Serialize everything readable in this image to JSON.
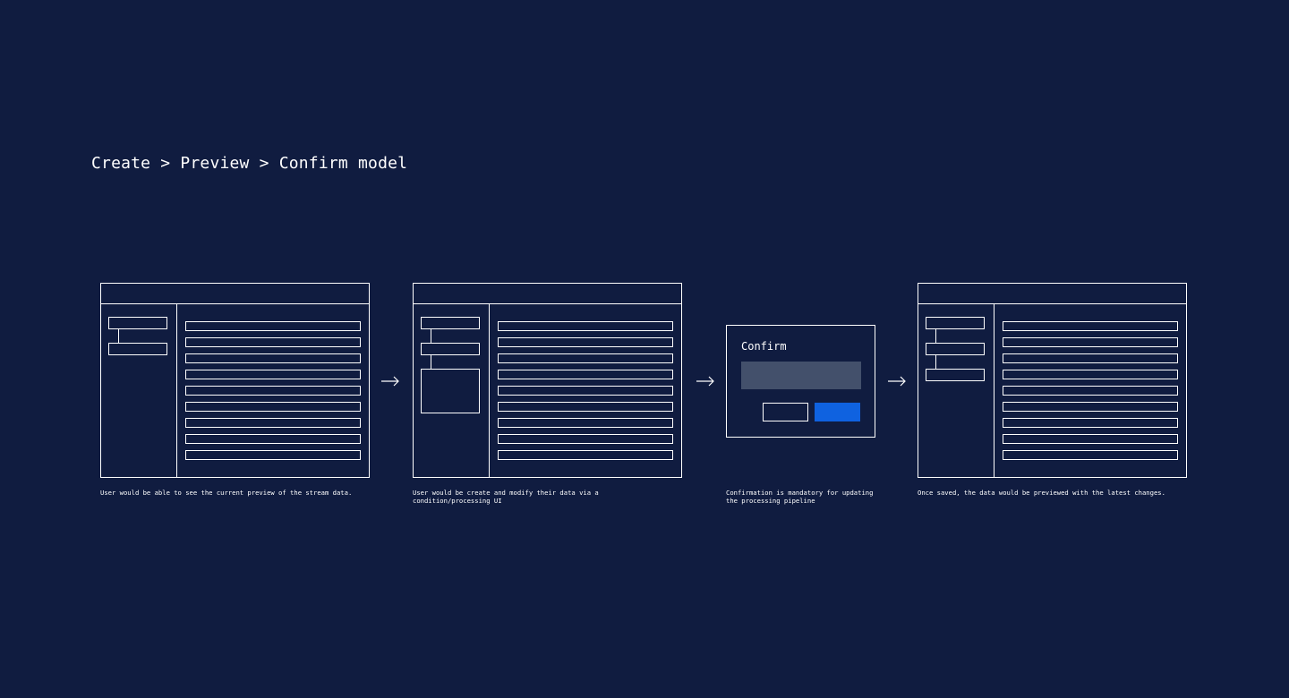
{
  "title": "Create > Preview > Confirm model",
  "steps": [
    {
      "caption": "User would be able to see the current preview of the stream data."
    },
    {
      "caption": "User would be create and modify their data via a condition/processing UI"
    },
    {
      "caption": "Confirmation is mandatory for updating the processing pipeline",
      "modal_title": "Confirm"
    },
    {
      "caption": "Once saved, the data would be previewed with the latest changes."
    }
  ],
  "colors": {
    "background": "#101c40",
    "stroke": "#ffffff",
    "field": "#43506b",
    "primary_button": "#0f62e0"
  },
  "icons": [
    "arrow-right-icon"
  ]
}
